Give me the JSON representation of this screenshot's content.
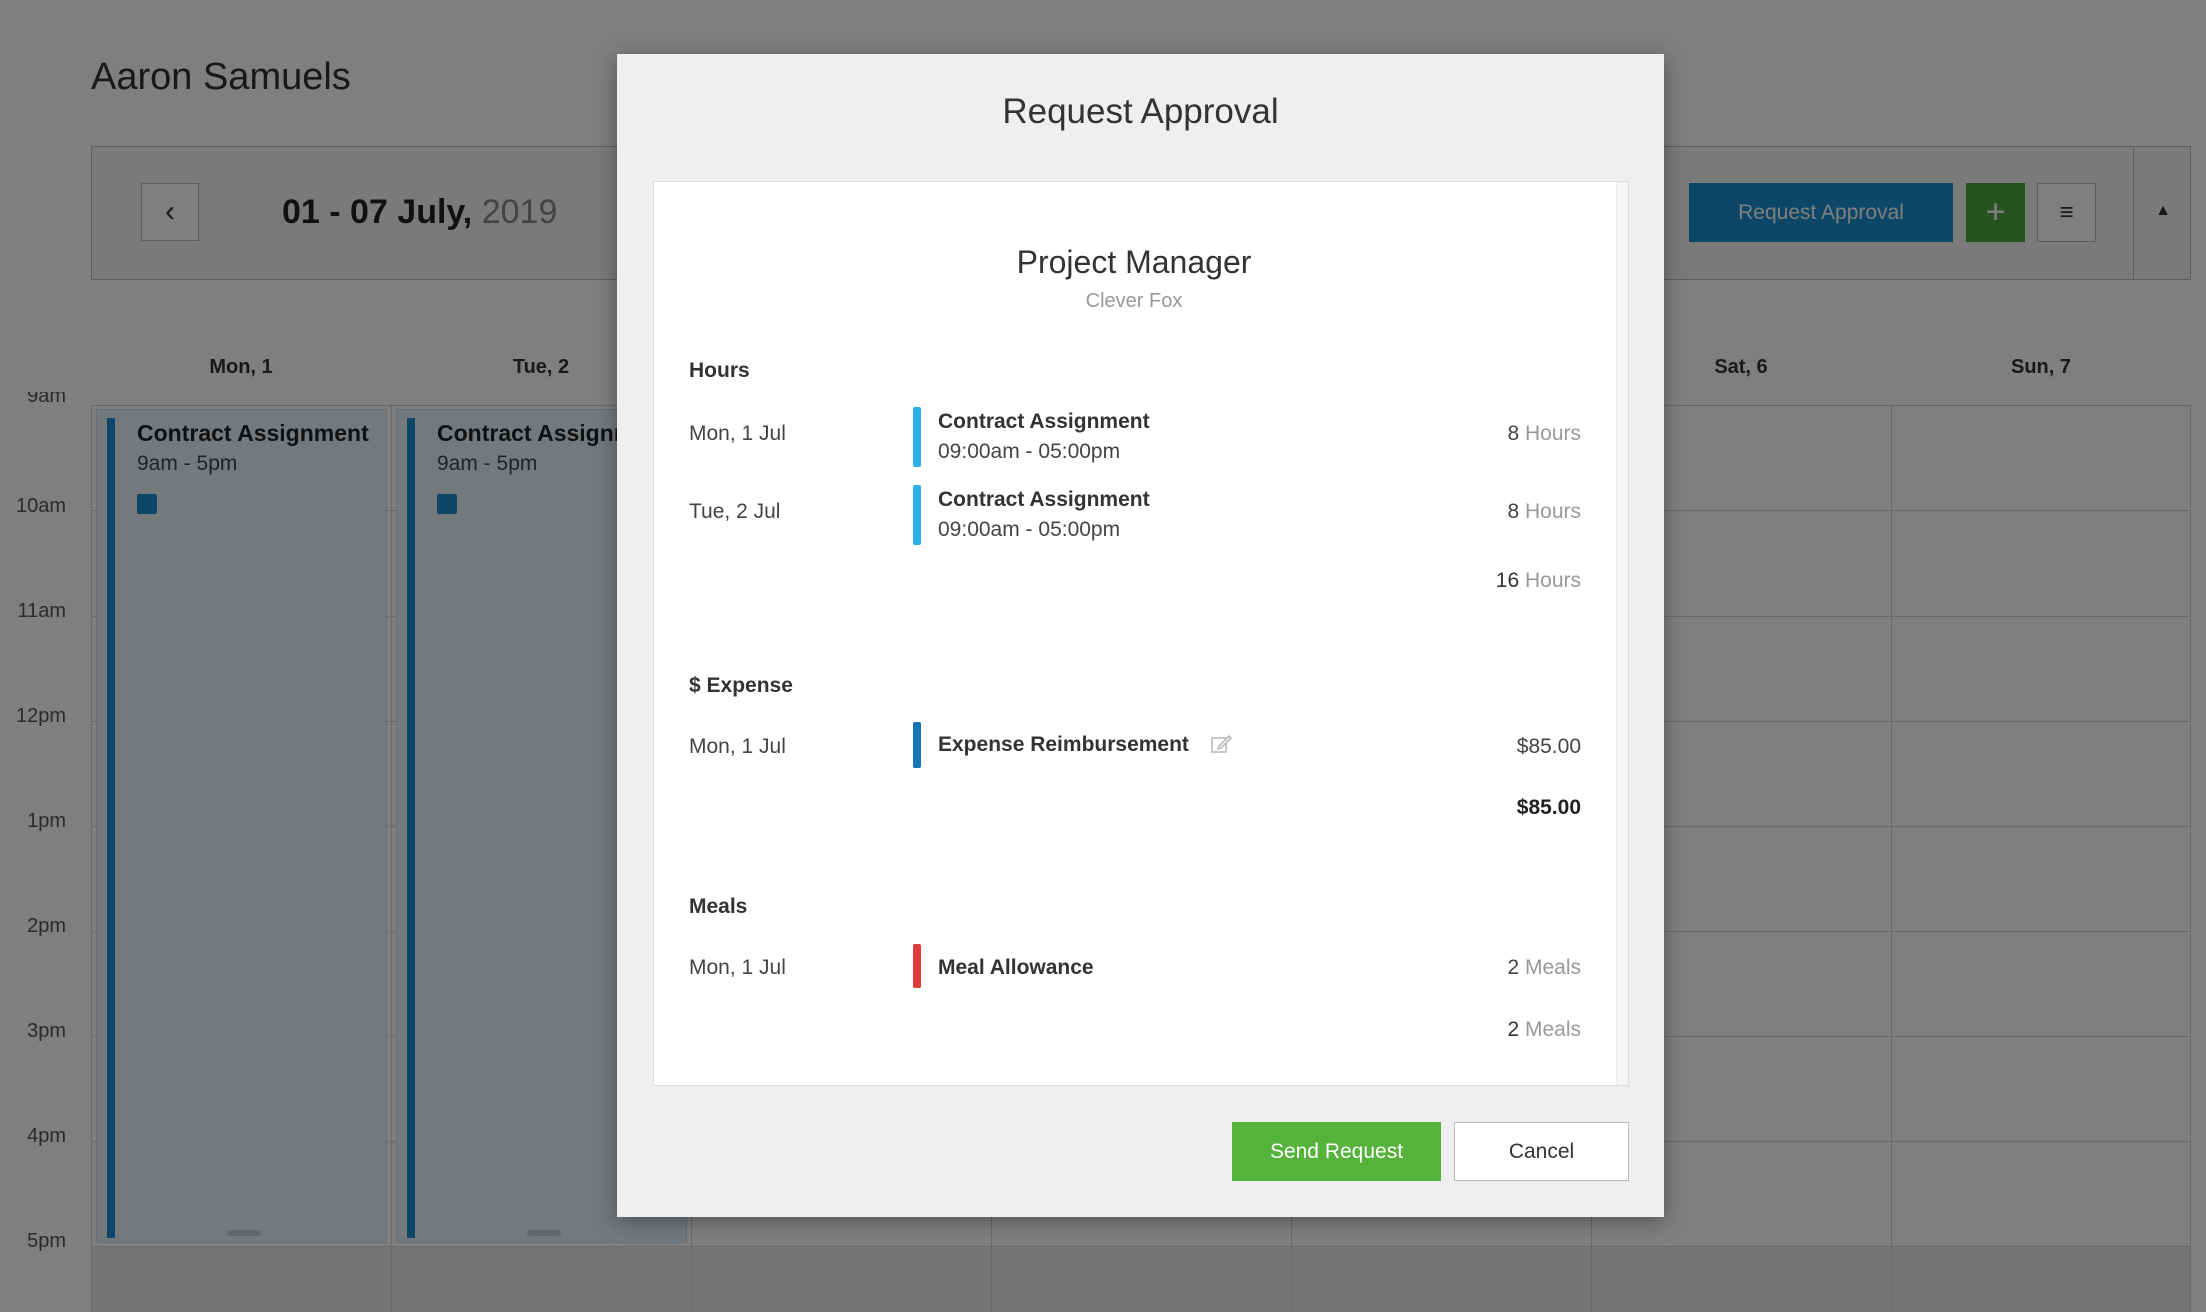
{
  "background": {
    "user_name": "Aaron Samuels",
    "nav_prev": "‹",
    "date_range": "01 - 07 July,",
    "year": "2019",
    "request_button": "Request Approval",
    "add_button": "+",
    "menu_button": "≡",
    "collapse_button": "▲",
    "days": [
      "Mon, 1",
      "Tue, 2",
      "Sat, 6",
      "Sun, 7"
    ],
    "times": [
      "9am",
      "10am",
      "11am",
      "12pm",
      "1pm",
      "2pm",
      "3pm",
      "4pm",
      "5pm"
    ],
    "events": [
      {
        "title": "Contract Assignment",
        "time": "9am - 5pm"
      },
      {
        "title": "Contract Assignment",
        "time": "9am - 5pm"
      }
    ],
    "colors": {
      "accent": "#1a8fd0",
      "add": "#4aa63a"
    }
  },
  "modal": {
    "title": "Request Approval",
    "role": "Project Manager",
    "company": "Clever Fox",
    "hours": {
      "heading": "Hours",
      "rows": [
        {
          "date": "Mon, 1 Jul",
          "name": "Contract Assignment",
          "time": "09:00am - 05:00pm",
          "qty": "8",
          "unit": "Hours"
        },
        {
          "date": "Tue, 2 Jul",
          "name": "Contract Assignment",
          "time": "09:00am - 05:00pm",
          "qty": "8",
          "unit": "Hours"
        }
      ],
      "total_qty": "16",
      "total_unit": "Hours",
      "color": "#2bb0ea"
    },
    "expense": {
      "heading": "$ Expense",
      "rows": [
        {
          "date": "Mon, 1 Jul",
          "name": "Expense Reimbursement",
          "amount": "$85.00"
        }
      ],
      "total": "$85.00",
      "color": "#1276b8"
    },
    "meals": {
      "heading": "Meals",
      "rows": [
        {
          "date": "Mon, 1 Jul",
          "name": "Meal Allowance",
          "qty": "2",
          "unit": "Meals"
        }
      ],
      "total_qty": "2",
      "total_unit": "Meals",
      "color": "#e03a3a"
    },
    "send_button": "Send Request",
    "cancel_button": "Cancel"
  }
}
